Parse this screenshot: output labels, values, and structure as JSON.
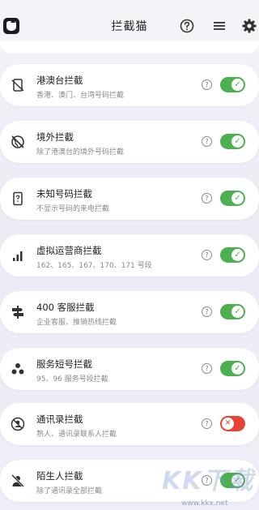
{
  "header": {
    "title": "拦截猫",
    "icons": [
      "app-logo-icon",
      "help-icon",
      "list-icon",
      "gear-icon"
    ]
  },
  "help_mark": "?",
  "items": [
    {
      "name": "港澳台拦截",
      "desc": "香港、澳门、台湾号码拦截",
      "icon": "phone-slash-icon",
      "enabled": true
    },
    {
      "name": "境外拦截",
      "desc": "除了港澳台的境外号码拦截",
      "icon": "globe-off-icon",
      "enabled": true
    },
    {
      "name": "未知号码拦截",
      "desc": "不显示号码的来电拦截",
      "icon": "unknown-phone-icon",
      "enabled": true
    },
    {
      "name": "虚拟运营商拦截",
      "desc": "162、165、167、170、171 号段",
      "icon": "signal-bars-icon",
      "enabled": true
    },
    {
      "name": "400 客服拦截",
      "desc": "企业客服、推销热线拦截",
      "icon": "signpost-icon",
      "enabled": true
    },
    {
      "name": "服务短号拦截",
      "desc": "95、96 服务号段拦截",
      "icon": "dots-cluster-icon",
      "enabled": true
    },
    {
      "name": "通讯录拦截",
      "desc": "熟人、通讯录联系人拦截",
      "icon": "contacts-block-icon",
      "enabled": false
    },
    {
      "name": "陌生人拦截",
      "desc": "除了通讯录全部拦截",
      "icon": "person-off-icon",
      "enabled": true
    }
  ],
  "toggle_marks": {
    "on": "✓",
    "off": "✕"
  },
  "watermark": {
    "text": "KK下载",
    "url": "www.kkx.net"
  },
  "colors": {
    "toggle_on": "#4caf50",
    "toggle_off": "#e84235",
    "background": "#eeeef6"
  }
}
